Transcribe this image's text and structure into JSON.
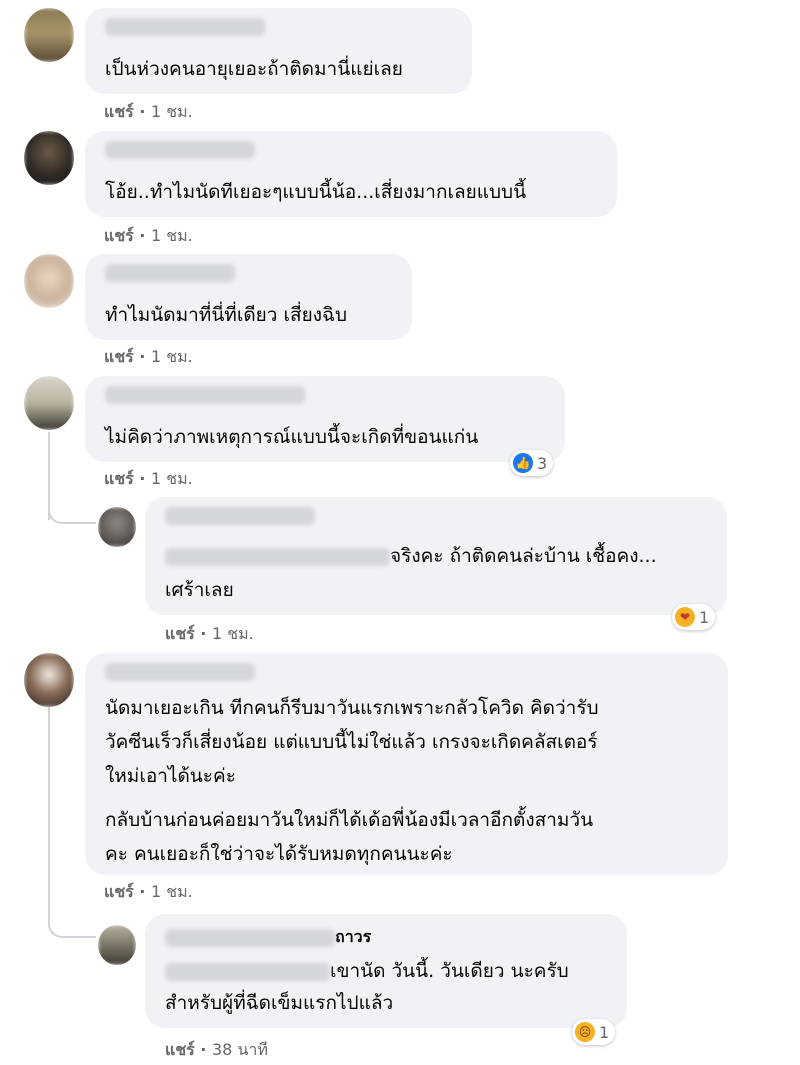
{
  "actions": {
    "share": "แชร์",
    "dot": "·"
  },
  "comments": [
    {
      "text": "เป็นห่วงคนอายุเยอะถ้าติดมานี่แย่เลย",
      "time": "1 ชม."
    },
    {
      "text": "โอ้ย..ทำไมนัดทีเยอะๆแบบนี้น้อ...เสี่ยงมากเลยแบบนี้",
      "time": "1 ชม."
    },
    {
      "text": "ทำไมนัดมาที่นี่ที่เดียว เสี่ยงฉิบ",
      "time": "1 ชม."
    },
    {
      "text": "ไม่คิดว่าภาพเหตุการณ์แบบนี้จะเกิดที่ขอนแก่น",
      "time": "1 ชม.",
      "reaction": {
        "icon": "like-icon",
        "count": "3"
      }
    },
    {
      "line1": "จริงคะ ถ้าติดคนล่ะบ้าน เชื้อคง...",
      "line2": "เศร้าเลย",
      "time": "1 ชม.",
      "reaction": {
        "icon": "care-icon",
        "count": "1"
      }
    },
    {
      "para1": [
        "นัดมาเยอะเกิน ทีกคนก็รีบมาวันแรกเพราะกลัวโควิด คิดว่ารับ",
        "วัคซีนเร็วก็เสี่ยงน้อย แต่แบบนี้ไม่ใช่แล้ว เกรงจะเกิดคลัสเตอร์",
        "ใหม่เอาได้นะค่ะ"
      ],
      "para2": [
        "กลับบ้านก่อนค่อยมาวันใหม่ก็ได้เด้อพี่น้องมีเวลาอีกตั้งสามวัน",
        "คะ คนเยอะก็ใช่ว่าจะได้รับหมดทุกคนนะค่ะ"
      ],
      "time": "1 ชม."
    },
    {
      "name_tail": "ถาวร",
      "line1": "เขานัด วันนี้. วันเดียว นะครับ",
      "line2": "สำหรับผู้ที่ฉีดเข็มแรกไปแล้ว",
      "time": "38 นาที",
      "reaction": {
        "icon": "sad-icon",
        "count": "1"
      }
    }
  ]
}
